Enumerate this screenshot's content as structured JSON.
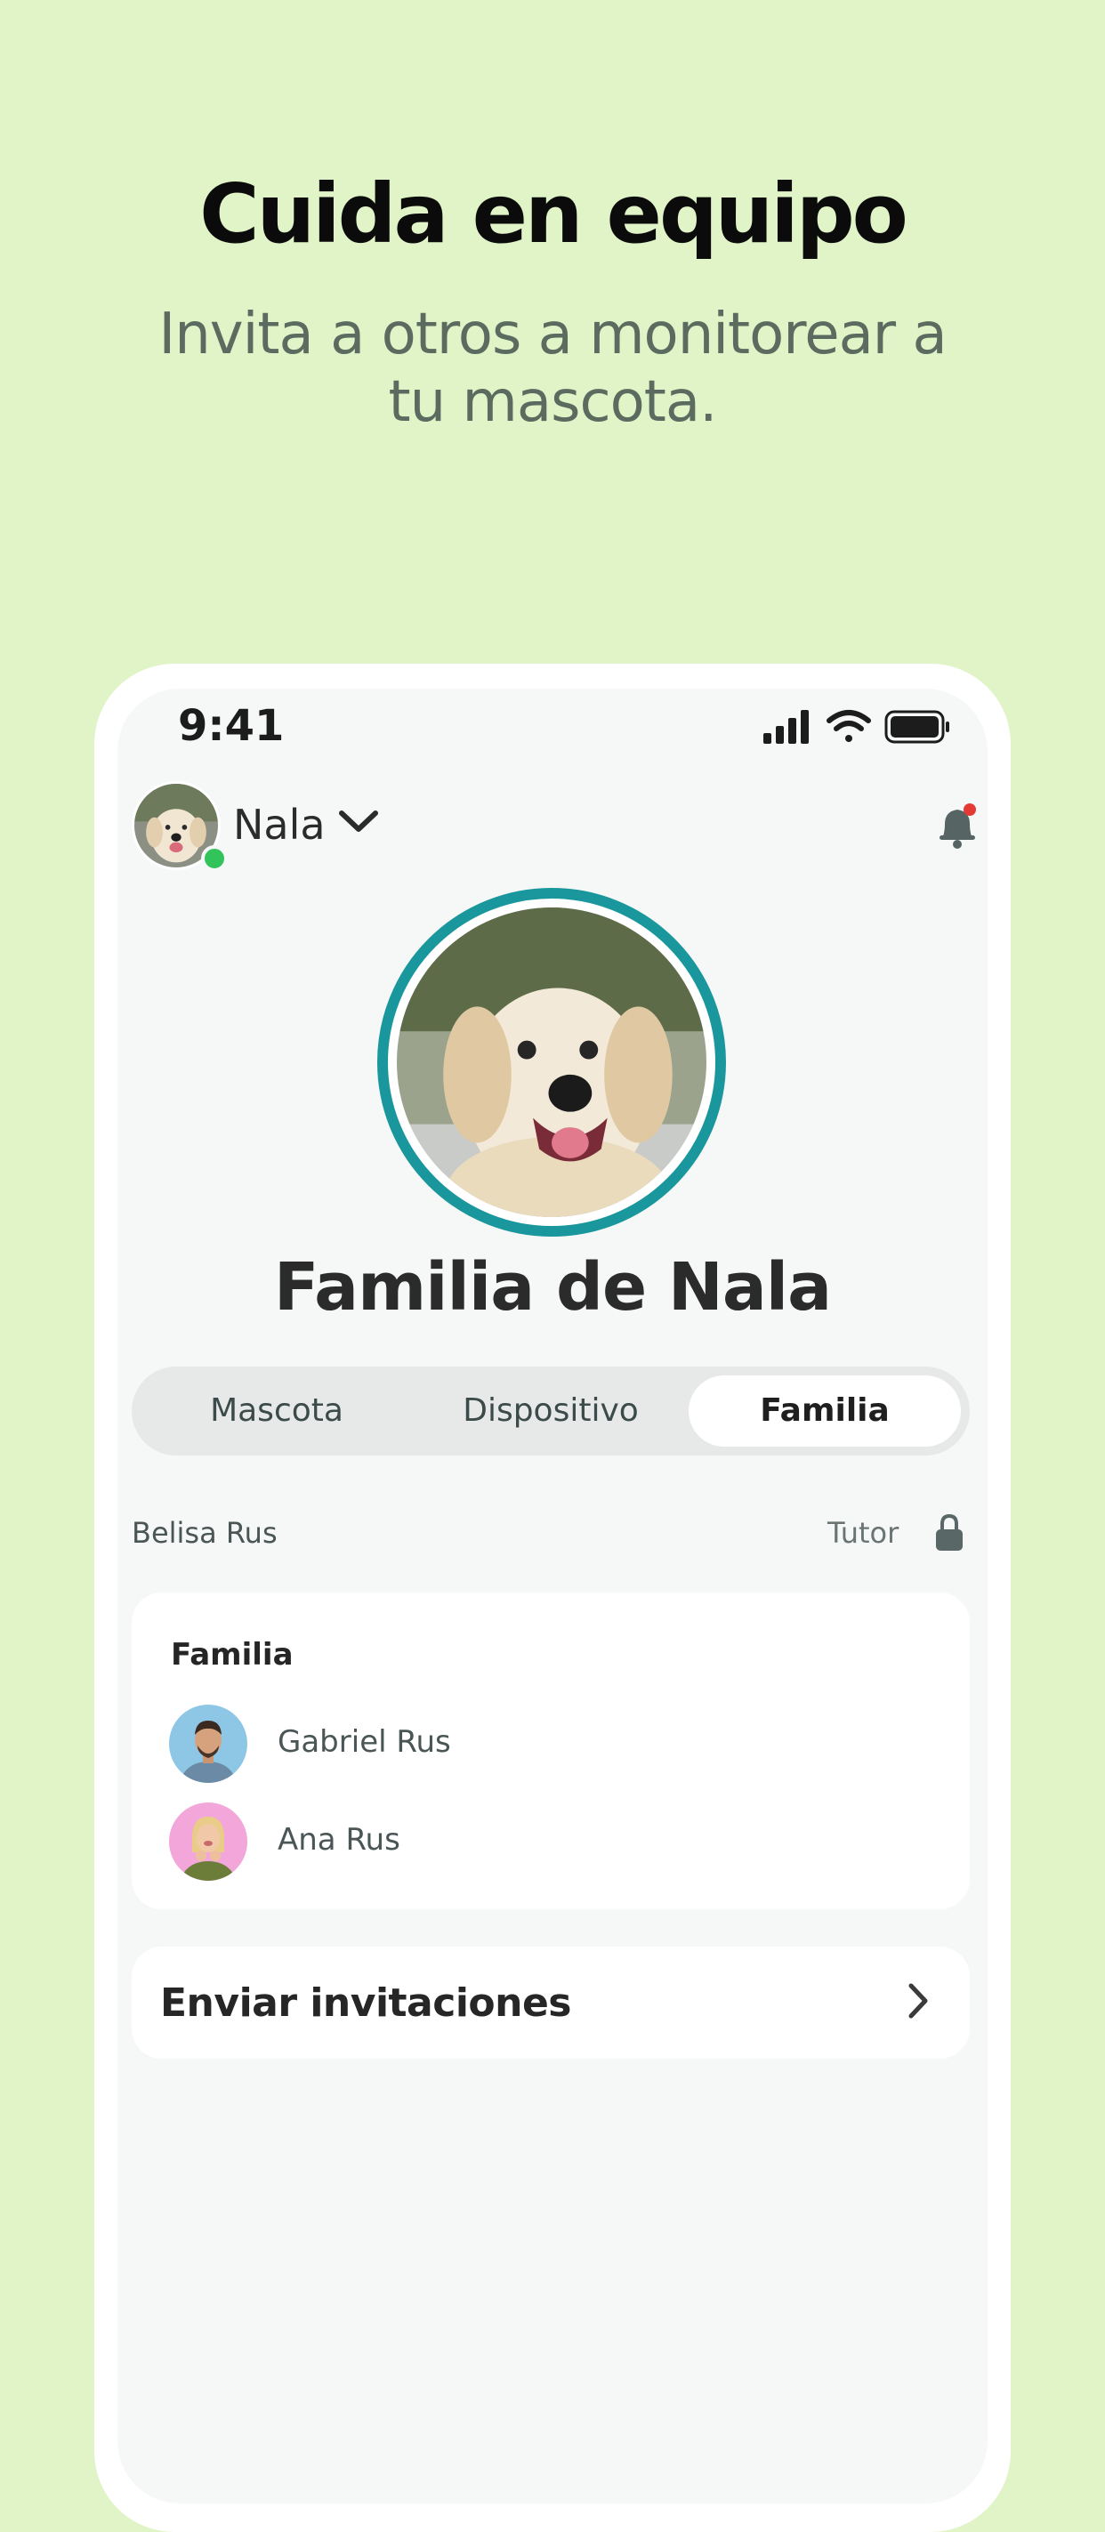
{
  "headline": "Cuida en equipo",
  "subline": "Invita a otros a monitorear a tu mascota.",
  "status_bar": {
    "time": "9:41",
    "icons": [
      "signal-icon",
      "wifi-icon",
      "battery-icon"
    ]
  },
  "header": {
    "pet_name": "Nala",
    "online": true
  },
  "profile": {
    "title": "Familia de Nala"
  },
  "tabs": [
    {
      "label": "Mascota",
      "active": false
    },
    {
      "label": "Dispositivo",
      "active": false
    },
    {
      "label": "Familia",
      "active": true
    }
  ],
  "owner": {
    "name": "Belisa Rus",
    "role": "Tutor"
  },
  "family_card": {
    "title": "Familia",
    "members": [
      {
        "name": "Gabriel Rus"
      },
      {
        "name": "Ana Rus"
      }
    ]
  },
  "invite": {
    "label": "Enviar invitaciones"
  },
  "colors": {
    "background": "#e0f4c7",
    "accent": "#1a979c",
    "online": "#33c35b",
    "notification": "#e53935"
  }
}
